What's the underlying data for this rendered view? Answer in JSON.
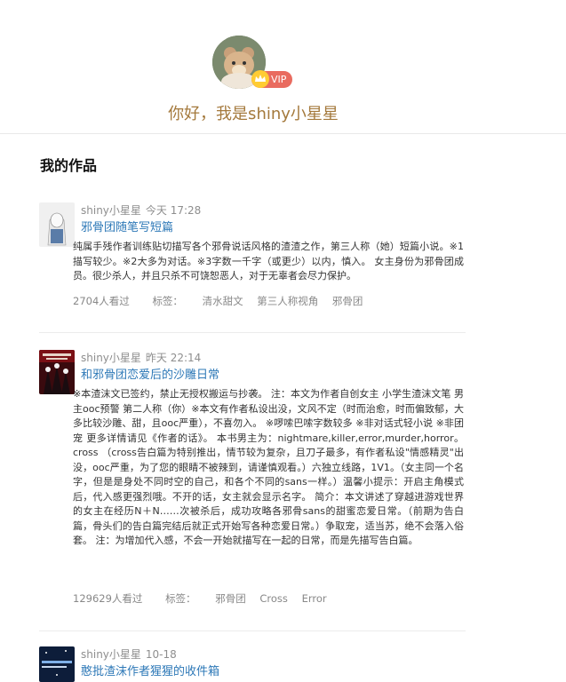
{
  "profile": {
    "vip_label": "VIP",
    "greeting": "你好，我是shiny小星星"
  },
  "section": {
    "title": "我的作品"
  },
  "works": [
    {
      "author": "shiny小星星",
      "time": "今天 17:28",
      "title": "邪骨团随笔写短篇",
      "description": "纯属手残作者训练贴切描写各个邪骨说话风格的渣渣之作，第三人称（她）短篇小说。※1描写较少。※2大多为对话。※3字数一千字（或更少）以内，慎入。 女主身份为邪骨团成员。很少杀人，并且只杀不可饶恕恶人，对于无辜者会尽力保护。",
      "views": "2704人看过",
      "tag_label": "标签：",
      "tags": [
        "清水甜文",
        "第三人称视角",
        "邪骨团"
      ]
    },
    {
      "author": "shiny小星星",
      "time": "昨天 22:14",
      "title": "和邪骨团恋爱后的沙雕日常",
      "description": "※本渣沫文已签约，禁止无授权搬运与抄袭。 注：本文为作者自创女主 小学生渣沫文笔 男主ooc预警 第二人称（你）※本文有作者私设出没，文风不定（时而治愈，时而偏致郁，大多比较沙雕、甜，且ooc严重），不喜勿入。 ※啰嗦巴嗦字数较多 ※非对话式轻小说 ※非团宠 更多详情请见《作者的话》。 本书男主为：nightmare,killer,error,murder,horror。cross （cross告白篇为特别推出，情节较为复杂，且刀子最多，有作者私设\"情感精灵\"出没，ooc严重，为了您的眼睛不被辣到，请谨慎观看。）六独立线路，1V1。（女主同一个名字，但是是身处不同时空的自己，和各个不同的sans一样。）温馨小提示：开启主角模式后，代入感更强烈哦。不开的话，女主就会显示名字。 简介：本文讲述了穿越进游戏世界的女主在经历N＋N……次被杀后，成功攻略各邪骨sans的甜蜜恋爱日常。（前期为告白篇，骨头们的告白篇完结后就正式开始写各种恋爱日常。）争取宠，适当苏，绝不会落入俗套。 注：为增加代入感，不会一开始就描写在一起的日常，而是先描写告白篇。",
      "views": "129629人看过",
      "tag_label": "标签：",
      "tags": [
        "邪骨团",
        "Cross",
        "Error"
      ]
    },
    {
      "author": "shiny小星星",
      "time": "10-18",
      "title": "憨批渣沫作者猩猩的收件箱"
    }
  ]
}
